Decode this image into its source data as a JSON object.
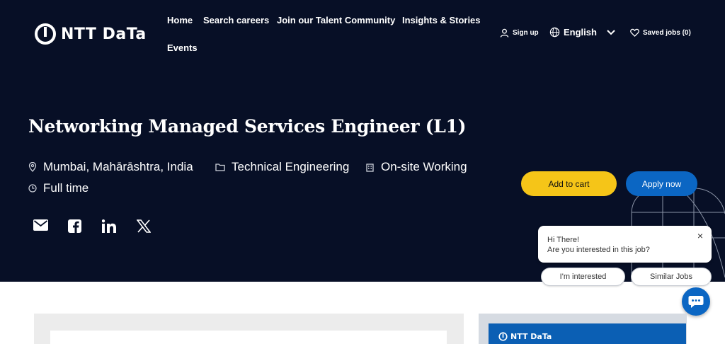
{
  "brand": {
    "logo_text": "NTT DaTa",
    "logo_icon": "ntt-ring-logo"
  },
  "nav": {
    "home": "Home",
    "search_careers": "Search careers",
    "talent_community": "Join our Talent Community",
    "insights": "Insights & Stories",
    "events": "Events"
  },
  "utility": {
    "sign_up": "Sign up",
    "language": "English",
    "saved_jobs": "Saved jobs (0)"
  },
  "job": {
    "title": "Networking Managed Services Engineer (L1)",
    "location": "Mumbai, Mahārāshtra, India",
    "category": "Technical Engineering",
    "work_type": "On-site Working",
    "schedule": "Full time"
  },
  "share": {
    "icons": [
      "email-icon",
      "facebook-icon",
      "linkedin-icon",
      "x-icon"
    ]
  },
  "actions": {
    "add_to_cart": "Add to cart",
    "apply_now": "Apply now"
  },
  "chat": {
    "greeting": "Hi There!",
    "question": "Are you interested in this job?",
    "close": "×",
    "option_interested": "I'm interested",
    "option_similar": "Similar Jobs"
  },
  "colors": {
    "hero_bg": "#070f26",
    "accent_yellow": "#f5c518",
    "accent_blue": "#0b66c3"
  }
}
